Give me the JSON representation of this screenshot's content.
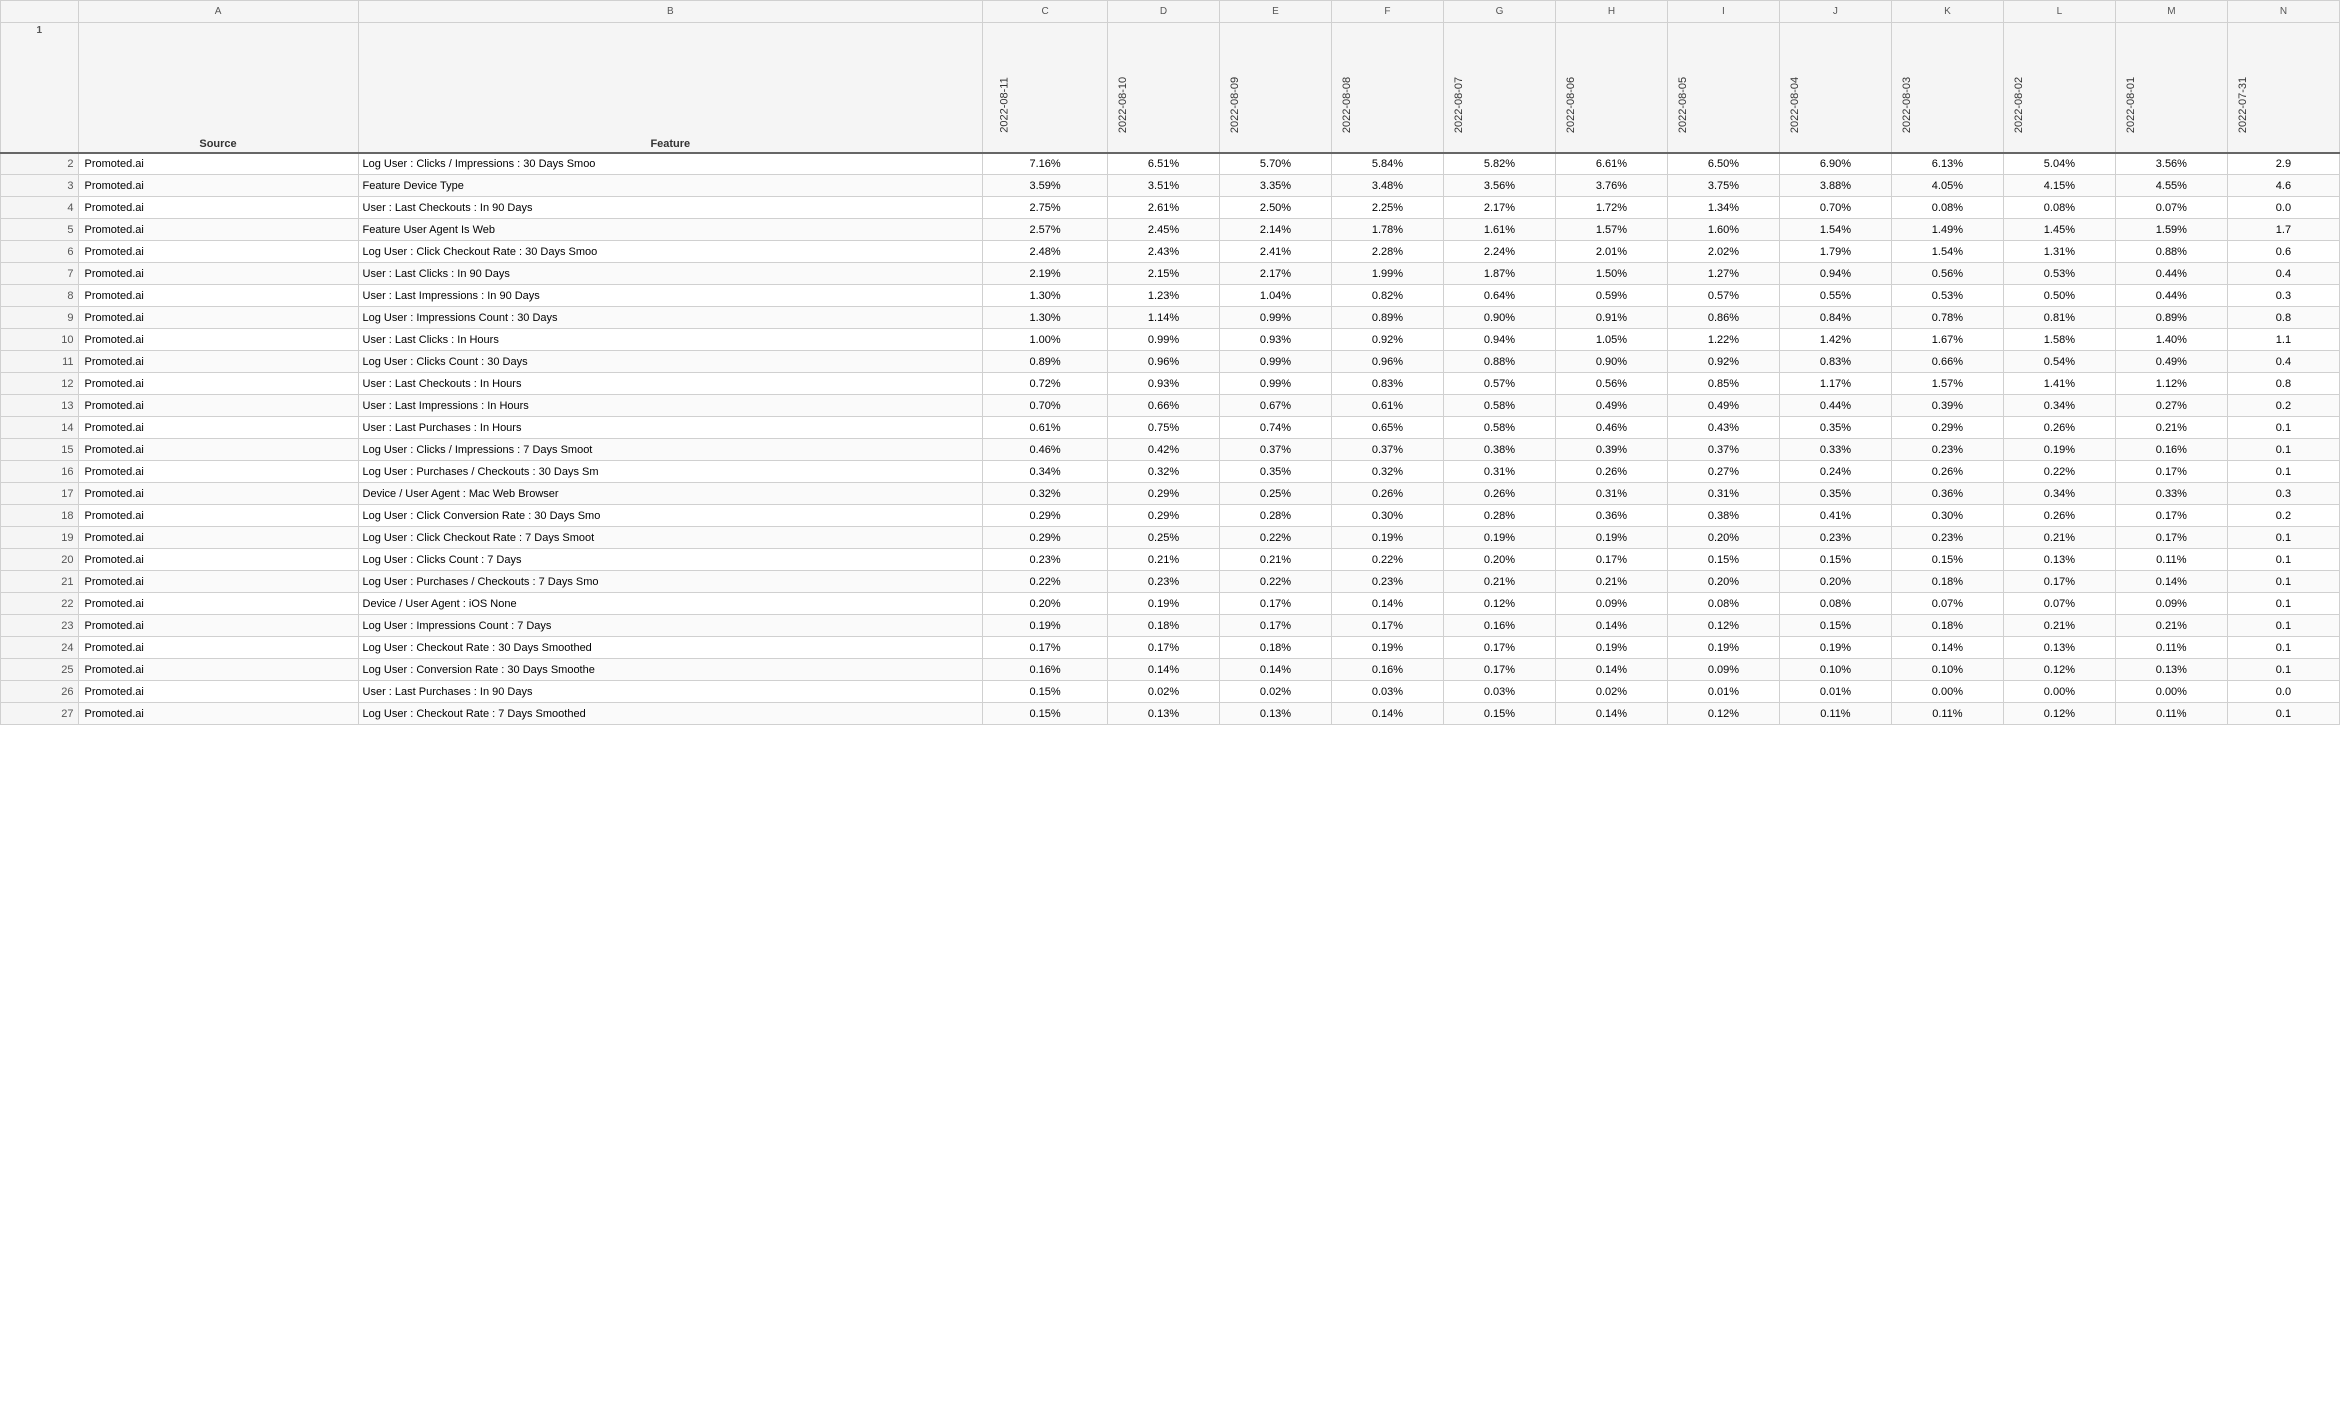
{
  "columns": {
    "letters": [
      "",
      "",
      "A",
      "B",
      "C",
      "D",
      "E",
      "F",
      "G",
      "H",
      "I",
      "J",
      "K",
      "L",
      "M",
      "N"
    ],
    "header_row1": {
      "rownum": "1",
      "source_label": "Source",
      "feature_label": "Feature",
      "dates": [
        "2022-08-11",
        "2022-08-10",
        "2022-08-09",
        "2022-08-08",
        "2022-08-07",
        "2022-08-06",
        "2022-08-05",
        "2022-08-04",
        "2022-08-03",
        "2022-08-02",
        "2022-08-01",
        "2022-07-31"
      ]
    }
  },
  "rows": [
    {
      "rownum": "2",
      "source": "Promoted.ai",
      "feature": "Log User : Clicks / Impressions : 30 Days Smoo",
      "c": "7.16%",
      "d": "6.51%",
      "e": "5.70%",
      "f": "5.84%",
      "g": "5.82%",
      "h": "6.61%",
      "i": "6.50%",
      "j": "6.90%",
      "k": "6.13%",
      "l": "5.04%",
      "m": "3.56%",
      "n": "2.9"
    },
    {
      "rownum": "3",
      "source": "Promoted.ai",
      "feature": "Feature Device Type",
      "c": "3.59%",
      "d": "3.51%",
      "e": "3.35%",
      "f": "3.48%",
      "g": "3.56%",
      "h": "3.76%",
      "i": "3.75%",
      "j": "3.88%",
      "k": "4.05%",
      "l": "4.15%",
      "m": "4.55%",
      "n": "4.6"
    },
    {
      "rownum": "4",
      "source": "Promoted.ai",
      "feature": "User : Last Checkouts : In 90 Days",
      "c": "2.75%",
      "d": "2.61%",
      "e": "2.50%",
      "f": "2.25%",
      "g": "2.17%",
      "h": "1.72%",
      "i": "1.34%",
      "j": "0.70%",
      "k": "0.08%",
      "l": "0.08%",
      "m": "0.07%",
      "n": "0.0"
    },
    {
      "rownum": "5",
      "source": "Promoted.ai",
      "feature": "Feature User Agent Is Web",
      "c": "2.57%",
      "d": "2.45%",
      "e": "2.14%",
      "f": "1.78%",
      "g": "1.61%",
      "h": "1.57%",
      "i": "1.60%",
      "j": "1.54%",
      "k": "1.49%",
      "l": "1.45%",
      "m": "1.59%",
      "n": "1.7"
    },
    {
      "rownum": "6",
      "source": "Promoted.ai",
      "feature": "Log User : Click Checkout Rate : 30 Days Smoo",
      "c": "2.48%",
      "d": "2.43%",
      "e": "2.41%",
      "f": "2.28%",
      "g": "2.24%",
      "h": "2.01%",
      "i": "2.02%",
      "j": "1.79%",
      "k": "1.54%",
      "l": "1.31%",
      "m": "0.88%",
      "n": "0.6"
    },
    {
      "rownum": "7",
      "source": "Promoted.ai",
      "feature": "User : Last Clicks : In 90 Days",
      "c": "2.19%",
      "d": "2.15%",
      "e": "2.17%",
      "f": "1.99%",
      "g": "1.87%",
      "h": "1.50%",
      "i": "1.27%",
      "j": "0.94%",
      "k": "0.56%",
      "l": "0.53%",
      "m": "0.44%",
      "n": "0.4"
    },
    {
      "rownum": "8",
      "source": "Promoted.ai",
      "feature": "User : Last Impressions : In 90 Days",
      "c": "1.30%",
      "d": "1.23%",
      "e": "1.04%",
      "f": "0.82%",
      "g": "0.64%",
      "h": "0.59%",
      "i": "0.57%",
      "j": "0.55%",
      "k": "0.53%",
      "l": "0.50%",
      "m": "0.44%",
      "n": "0.3"
    },
    {
      "rownum": "9",
      "source": "Promoted.ai",
      "feature": "Log User : Impressions Count : 30 Days",
      "c": "1.30%",
      "d": "1.14%",
      "e": "0.99%",
      "f": "0.89%",
      "g": "0.90%",
      "h": "0.91%",
      "i": "0.86%",
      "j": "0.84%",
      "k": "0.78%",
      "l": "0.81%",
      "m": "0.89%",
      "n": "0.8"
    },
    {
      "rownum": "10",
      "source": "Promoted.ai",
      "feature": "User : Last Clicks : In Hours",
      "c": "1.00%",
      "d": "0.99%",
      "e": "0.93%",
      "f": "0.92%",
      "g": "0.94%",
      "h": "1.05%",
      "i": "1.22%",
      "j": "1.42%",
      "k": "1.67%",
      "l": "1.58%",
      "m": "1.40%",
      "n": "1.1"
    },
    {
      "rownum": "11",
      "source": "Promoted.ai",
      "feature": "Log User : Clicks Count : 30 Days",
      "c": "0.89%",
      "d": "0.96%",
      "e": "0.99%",
      "f": "0.96%",
      "g": "0.88%",
      "h": "0.90%",
      "i": "0.92%",
      "j": "0.83%",
      "k": "0.66%",
      "l": "0.54%",
      "m": "0.49%",
      "n": "0.4"
    },
    {
      "rownum": "12",
      "source": "Promoted.ai",
      "feature": "User : Last Checkouts : In Hours",
      "c": "0.72%",
      "d": "0.93%",
      "e": "0.99%",
      "f": "0.83%",
      "g": "0.57%",
      "h": "0.56%",
      "i": "0.85%",
      "j": "1.17%",
      "k": "1.57%",
      "l": "1.41%",
      "m": "1.12%",
      "n": "0.8"
    },
    {
      "rownum": "13",
      "source": "Promoted.ai",
      "feature": "User : Last Impressions : In Hours",
      "c": "0.70%",
      "d": "0.66%",
      "e": "0.67%",
      "f": "0.61%",
      "g": "0.58%",
      "h": "0.49%",
      "i": "0.49%",
      "j": "0.44%",
      "k": "0.39%",
      "l": "0.34%",
      "m": "0.27%",
      "n": "0.2"
    },
    {
      "rownum": "14",
      "source": "Promoted.ai",
      "feature": "User : Last Purchases : In Hours",
      "c": "0.61%",
      "d": "0.75%",
      "e": "0.74%",
      "f": "0.65%",
      "g": "0.58%",
      "h": "0.46%",
      "i": "0.43%",
      "j": "0.35%",
      "k": "0.29%",
      "l": "0.26%",
      "m": "0.21%",
      "n": "0.1"
    },
    {
      "rownum": "15",
      "source": "Promoted.ai",
      "feature": "Log User : Clicks / Impressions : 7 Days Smoot",
      "c": "0.46%",
      "d": "0.42%",
      "e": "0.37%",
      "f": "0.37%",
      "g": "0.38%",
      "h": "0.39%",
      "i": "0.37%",
      "j": "0.33%",
      "k": "0.23%",
      "l": "0.19%",
      "m": "0.16%",
      "n": "0.1"
    },
    {
      "rownum": "16",
      "source": "Promoted.ai",
      "feature": "Log User : Purchases / Checkouts : 30 Days Sm",
      "c": "0.34%",
      "d": "0.32%",
      "e": "0.35%",
      "f": "0.32%",
      "g": "0.31%",
      "h": "0.26%",
      "i": "0.27%",
      "j": "0.24%",
      "k": "0.26%",
      "l": "0.22%",
      "m": "0.17%",
      "n": "0.1"
    },
    {
      "rownum": "17",
      "source": "Promoted.ai",
      "feature": "Device / User Agent : Mac Web Browser",
      "c": "0.32%",
      "d": "0.29%",
      "e": "0.25%",
      "f": "0.26%",
      "g": "0.26%",
      "h": "0.31%",
      "i": "0.31%",
      "j": "0.35%",
      "k": "0.36%",
      "l": "0.34%",
      "m": "0.33%",
      "n": "0.3"
    },
    {
      "rownum": "18",
      "source": "Promoted.ai",
      "feature": "Log User : Click Conversion Rate : 30 Days Smo",
      "c": "0.29%",
      "d": "0.29%",
      "e": "0.28%",
      "f": "0.30%",
      "g": "0.28%",
      "h": "0.36%",
      "i": "0.38%",
      "j": "0.41%",
      "k": "0.30%",
      "l": "0.26%",
      "m": "0.17%",
      "n": "0.2"
    },
    {
      "rownum": "19",
      "source": "Promoted.ai",
      "feature": "Log User : Click Checkout Rate : 7 Days Smoot",
      "c": "0.29%",
      "d": "0.25%",
      "e": "0.22%",
      "f": "0.19%",
      "g": "0.19%",
      "h": "0.19%",
      "i": "0.20%",
      "j": "0.23%",
      "k": "0.23%",
      "l": "0.21%",
      "m": "0.17%",
      "n": "0.1"
    },
    {
      "rownum": "20",
      "source": "Promoted.ai",
      "feature": "Log User : Clicks Count : 7 Days",
      "c": "0.23%",
      "d": "0.21%",
      "e": "0.21%",
      "f": "0.22%",
      "g": "0.20%",
      "h": "0.17%",
      "i": "0.15%",
      "j": "0.15%",
      "k": "0.15%",
      "l": "0.13%",
      "m": "0.11%",
      "n": "0.1"
    },
    {
      "rownum": "21",
      "source": "Promoted.ai",
      "feature": "Log User : Purchases / Checkouts : 7 Days Smo",
      "c": "0.22%",
      "d": "0.23%",
      "e": "0.22%",
      "f": "0.23%",
      "g": "0.21%",
      "h": "0.21%",
      "i": "0.20%",
      "j": "0.20%",
      "k": "0.18%",
      "l": "0.17%",
      "m": "0.14%",
      "n": "0.1"
    },
    {
      "rownum": "22",
      "source": "Promoted.ai",
      "feature": "Device / User Agent : iOS None",
      "c": "0.20%",
      "d": "0.19%",
      "e": "0.17%",
      "f": "0.14%",
      "g": "0.12%",
      "h": "0.09%",
      "i": "0.08%",
      "j": "0.08%",
      "k": "0.07%",
      "l": "0.07%",
      "m": "0.09%",
      "n": "0.1"
    },
    {
      "rownum": "23",
      "source": "Promoted.ai",
      "feature": "Log User : Impressions Count : 7 Days",
      "c": "0.19%",
      "d": "0.18%",
      "e": "0.17%",
      "f": "0.17%",
      "g": "0.16%",
      "h": "0.14%",
      "i": "0.12%",
      "j": "0.15%",
      "k": "0.18%",
      "l": "0.21%",
      "m": "0.21%",
      "n": "0.1"
    },
    {
      "rownum": "24",
      "source": "Promoted.ai",
      "feature": "Log User : Checkout Rate : 30 Days Smoothed",
      "c": "0.17%",
      "d": "0.17%",
      "e": "0.18%",
      "f": "0.19%",
      "g": "0.17%",
      "h": "0.19%",
      "i": "0.19%",
      "j": "0.19%",
      "k": "0.14%",
      "l": "0.13%",
      "m": "0.11%",
      "n": "0.1"
    },
    {
      "rownum": "25",
      "source": "Promoted.ai",
      "feature": "Log User : Conversion Rate : 30 Days Smoothe",
      "c": "0.16%",
      "d": "0.14%",
      "e": "0.14%",
      "f": "0.16%",
      "g": "0.17%",
      "h": "0.14%",
      "i": "0.09%",
      "j": "0.10%",
      "k": "0.10%",
      "l": "0.12%",
      "m": "0.13%",
      "n": "0.1"
    },
    {
      "rownum": "26",
      "source": "Promoted.ai",
      "feature": "User : Last Purchases : In 90 Days",
      "c": "0.15%",
      "d": "0.02%",
      "e": "0.02%",
      "f": "0.03%",
      "g": "0.03%",
      "h": "0.02%",
      "i": "0.01%",
      "j": "0.01%",
      "k": "0.00%",
      "l": "0.00%",
      "m": "0.00%",
      "n": "0.0"
    },
    {
      "rownum": "27",
      "source": "Promoted.ai",
      "feature": "Log User : Checkout Rate : 7 Days Smoothed",
      "c": "0.15%",
      "d": "0.13%",
      "e": "0.13%",
      "f": "0.14%",
      "g": "0.15%",
      "h": "0.14%",
      "i": "0.12%",
      "j": "0.11%",
      "k": "0.11%",
      "l": "0.12%",
      "m": "0.11%",
      "n": "0.1"
    }
  ]
}
